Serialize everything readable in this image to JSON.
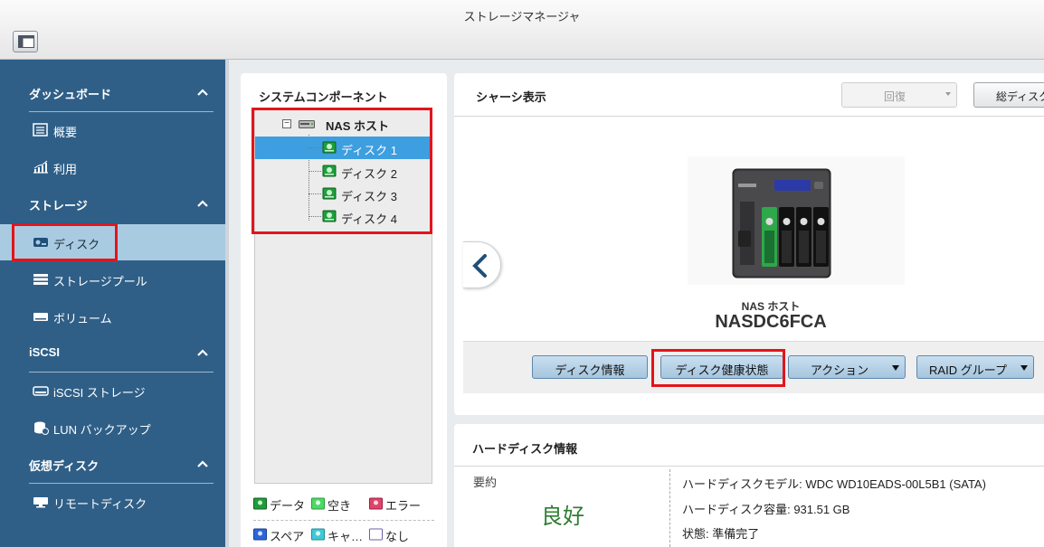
{
  "window": {
    "title": "ストレージマネージャ"
  },
  "sidebar": {
    "sections": [
      {
        "title": "ダッシュボード",
        "items": [
          {
            "label": "概要",
            "icon": "overview-icon"
          },
          {
            "label": "利用",
            "icon": "usage-chart-icon"
          }
        ]
      },
      {
        "title": "ストレージ",
        "items": [
          {
            "label": "ディスク",
            "icon": "disk-icon",
            "active": true
          },
          {
            "label": "ストレージプール",
            "icon": "storage-pool-icon"
          },
          {
            "label": "ボリューム",
            "icon": "volume-icon"
          }
        ]
      },
      {
        "title": "iSCSI",
        "items": [
          {
            "label": "iSCSI ストレージ",
            "icon": "iscsi-storage-icon"
          },
          {
            "label": "LUN バックアップ",
            "icon": "lun-backup-icon"
          }
        ]
      },
      {
        "title": "仮想ディスク",
        "items": [
          {
            "label": "リモートディスク",
            "icon": "remote-disk-icon"
          }
        ]
      }
    ]
  },
  "components": {
    "title": "システムコンポーネント",
    "host": "NAS ホスト",
    "disks": [
      "ディスク 1",
      "ディスク 2",
      "ディスク 3",
      "ディスク 4"
    ],
    "legend": [
      {
        "label": "データ",
        "color": "#1e9e3a"
      },
      {
        "label": "空き",
        "color": "#4cd964"
      },
      {
        "label": "エラー",
        "color": "#e0436a"
      },
      {
        "label": "スペア",
        "color": "#2e66d8"
      },
      {
        "label": "キャ…",
        "color": "#3fc9d6"
      },
      {
        "label": "なし",
        "color": "#ffffff"
      }
    ]
  },
  "chassis": {
    "title": "シャーシ表示",
    "recover_label": "回復",
    "total_disk_label": "総ディスク",
    "device_label": "NAS ホスト",
    "device_id": "NASDC6FCA",
    "buttons": {
      "disk_info": "ディスク情報",
      "disk_health": "ディスク健康状態",
      "action": "アクション",
      "raid_group": "RAID グループ"
    }
  },
  "hdd_info": {
    "title": "ハードディスク情報",
    "summary_label": "要約",
    "status": "良好",
    "model": "ハードディスクモデル: WDC WD10EADS-00L5B1 (SATA)",
    "capacity": "ハードディスク容量: 931.51 GB",
    "state": "状態: 準備完了"
  },
  "colors": {
    "sidebar": "#2f5f87",
    "sidebar_active": "#a9cbe2",
    "tree_selected": "#3d9ee0",
    "highlight": "#e3141b",
    "good": "#2e7d32"
  }
}
